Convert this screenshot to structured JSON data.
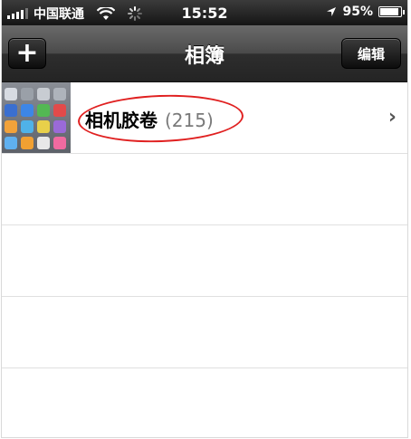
{
  "status_bar": {
    "carrier": "中国联通",
    "time": "15:52",
    "battery_percent": "95%",
    "battery_level": 0.95,
    "icons": [
      "signal-icon",
      "wifi-icon",
      "activity-spinner-icon",
      "location-arrow-icon",
      "battery-icon"
    ]
  },
  "nav_bar": {
    "title": "相簿",
    "add_label": "+",
    "edit_label": "编辑"
  },
  "albums": [
    {
      "name": "相机胶卷",
      "count": "(215)"
    }
  ],
  "colors": {
    "highlight": "#e02020",
    "nav_background": "#2e2e2e"
  }
}
